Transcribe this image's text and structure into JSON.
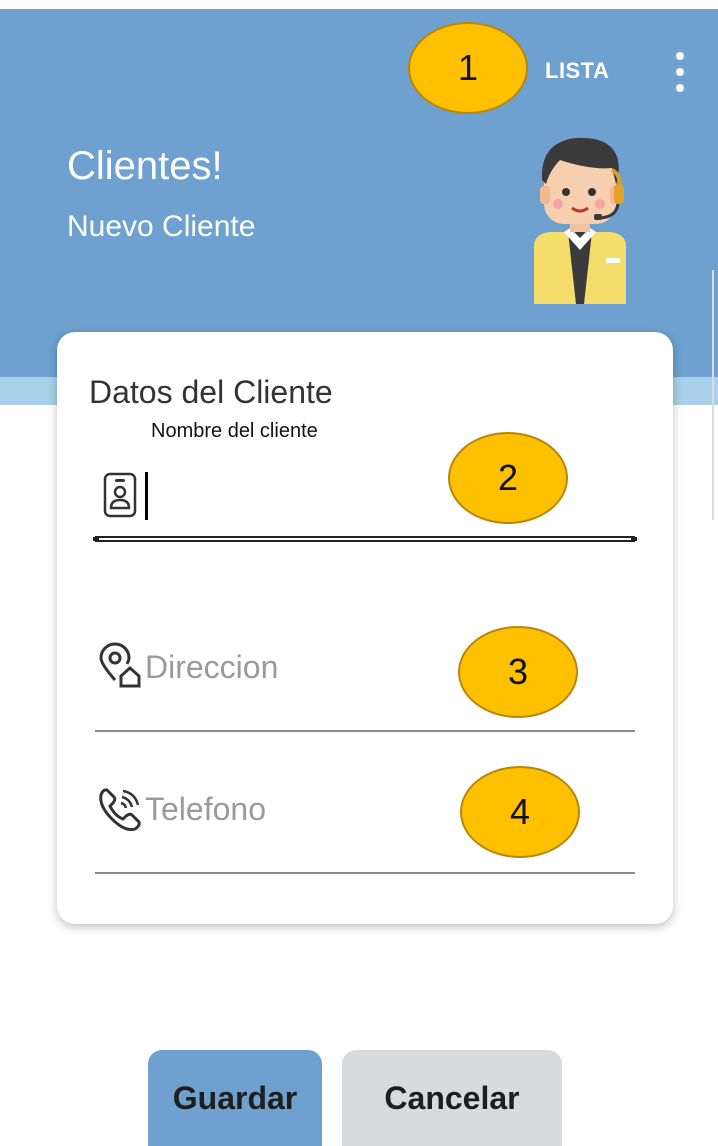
{
  "header": {
    "lista_label": "LISTA",
    "title": "Clientes!",
    "subtitle": "Nuevo Cliente"
  },
  "card": {
    "title": "Datos del Cliente",
    "fields": [
      {
        "label": "Nombre del cliente",
        "value": "",
        "placeholder": "",
        "icon": "id-card-icon"
      },
      {
        "value": "",
        "placeholder": "Direccion",
        "icon": "location-home-icon"
      },
      {
        "value": "",
        "placeholder": "Telefono",
        "icon": "phone-ringing-icon"
      }
    ]
  },
  "callouts": [
    "1",
    "2",
    "3",
    "4"
  ],
  "buttons": {
    "save_label": "Guardar",
    "cancel_label": "Cancelar"
  },
  "colors": {
    "header_bg": "#6ea1cf",
    "strip_bg": "#a9d0ea",
    "callout_fill": "#ffc000",
    "save_bg": "#6ea1cf",
    "cancel_bg": "#d8dadd"
  }
}
